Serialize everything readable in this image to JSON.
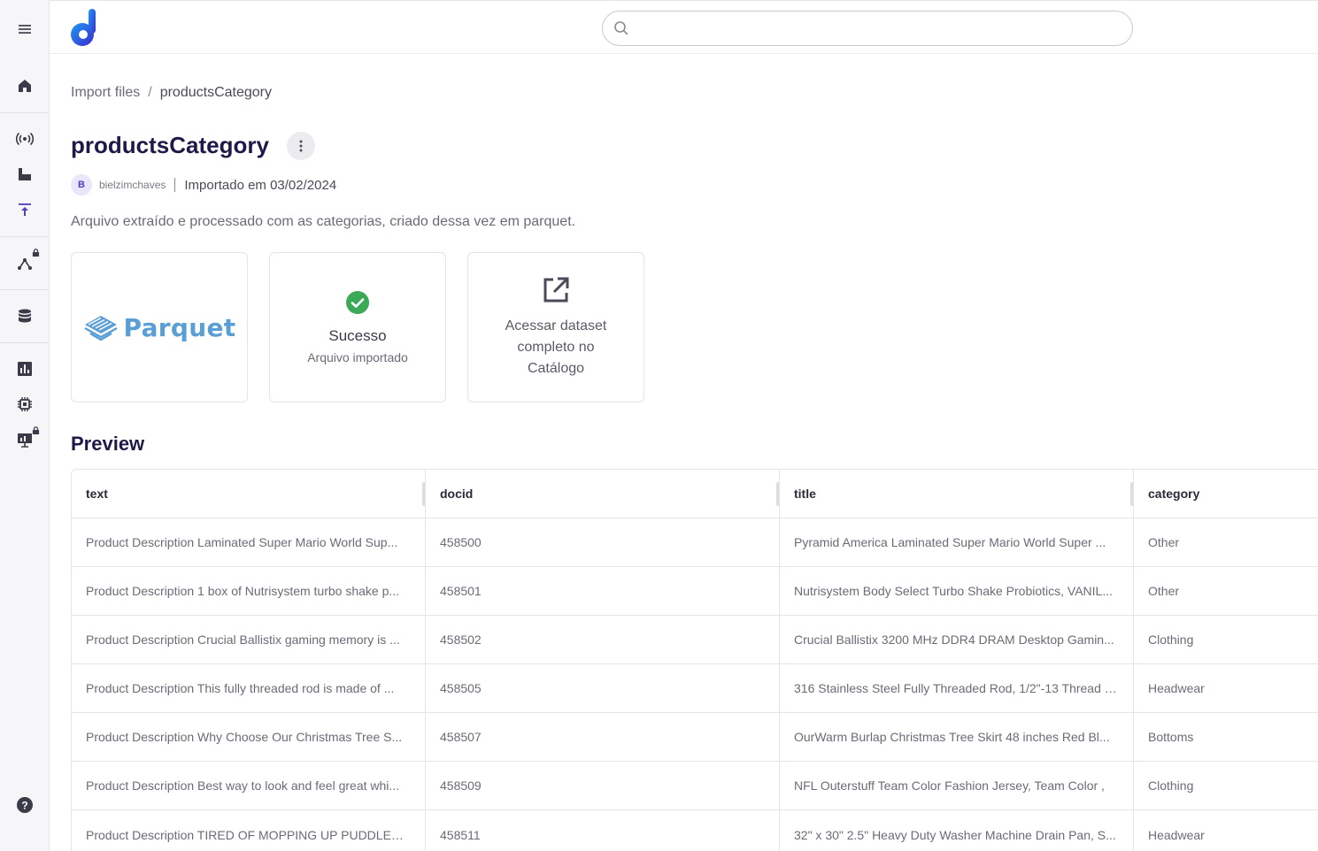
{
  "app": {
    "logo_icon": "d-logo",
    "search_placeholder": ""
  },
  "breadcrumb": {
    "parent": "Import files",
    "separator": "/",
    "current": "productsCategory"
  },
  "page": {
    "title": "productsCategory",
    "author_initial": "B",
    "author": "bielzimchaves",
    "imported_label": "Importado em 03/02/2024",
    "description": "Arquivo extraído e processado com as categorias, criado dessa vez em parquet."
  },
  "cards": {
    "format_logo_text": "Parquet",
    "status_title": "Sucesso",
    "status_subtitle": "Arquivo importado",
    "link_label": "Acessar dataset completo no Catálogo"
  },
  "preview": {
    "title": "Preview",
    "columns": [
      "text",
      "docid",
      "title",
      "category"
    ],
    "rows": [
      [
        "Product Description Laminated Super Mario World Sup...",
        "458500",
        "Pyramid America Laminated Super Mario World Super ...",
        "Other"
      ],
      [
        "Product Description 1 box of Nutrisystem turbo shake p...",
        "458501",
        "Nutrisystem Body Select Turbo Shake Probiotics, VANIL...",
        "Other"
      ],
      [
        "Product Description Crucial Ballistix gaming memory is ...",
        "458502",
        "Crucial Ballistix 3200 MHz DDR4 DRAM Desktop Gamin...",
        "Clothing"
      ],
      [
        "Product Description This fully threaded rod is made of ...",
        "458505",
        "316 Stainless Steel Fully Threaded Rod, 1/2\"-13 Thread S...",
        "Headwear"
      ],
      [
        "Product Description Why Choose Our Christmas Tree S...",
        "458507",
        "OurWarm Burlap Christmas Tree Skirt 48 inches Red Bl...",
        "Bottoms"
      ],
      [
        "Product Description Best way to look and feel great whi...",
        "458509",
        "NFL Outerstuff Team Color Fashion Jersey, Team Color ,",
        "Clothing"
      ],
      [
        "Product Description TIRED OF MOPPING UP PUDDLES ...",
        "458511",
        "32\" x 30\" 2.5\" Heavy Duty Washer Machine Drain Pan, S...",
        "Headwear"
      ]
    ]
  },
  "colors": {
    "accent": "#4b3fc2",
    "title": "#1d1a4a",
    "success": "#3aaa57",
    "parquet": "#5a9ed6"
  }
}
